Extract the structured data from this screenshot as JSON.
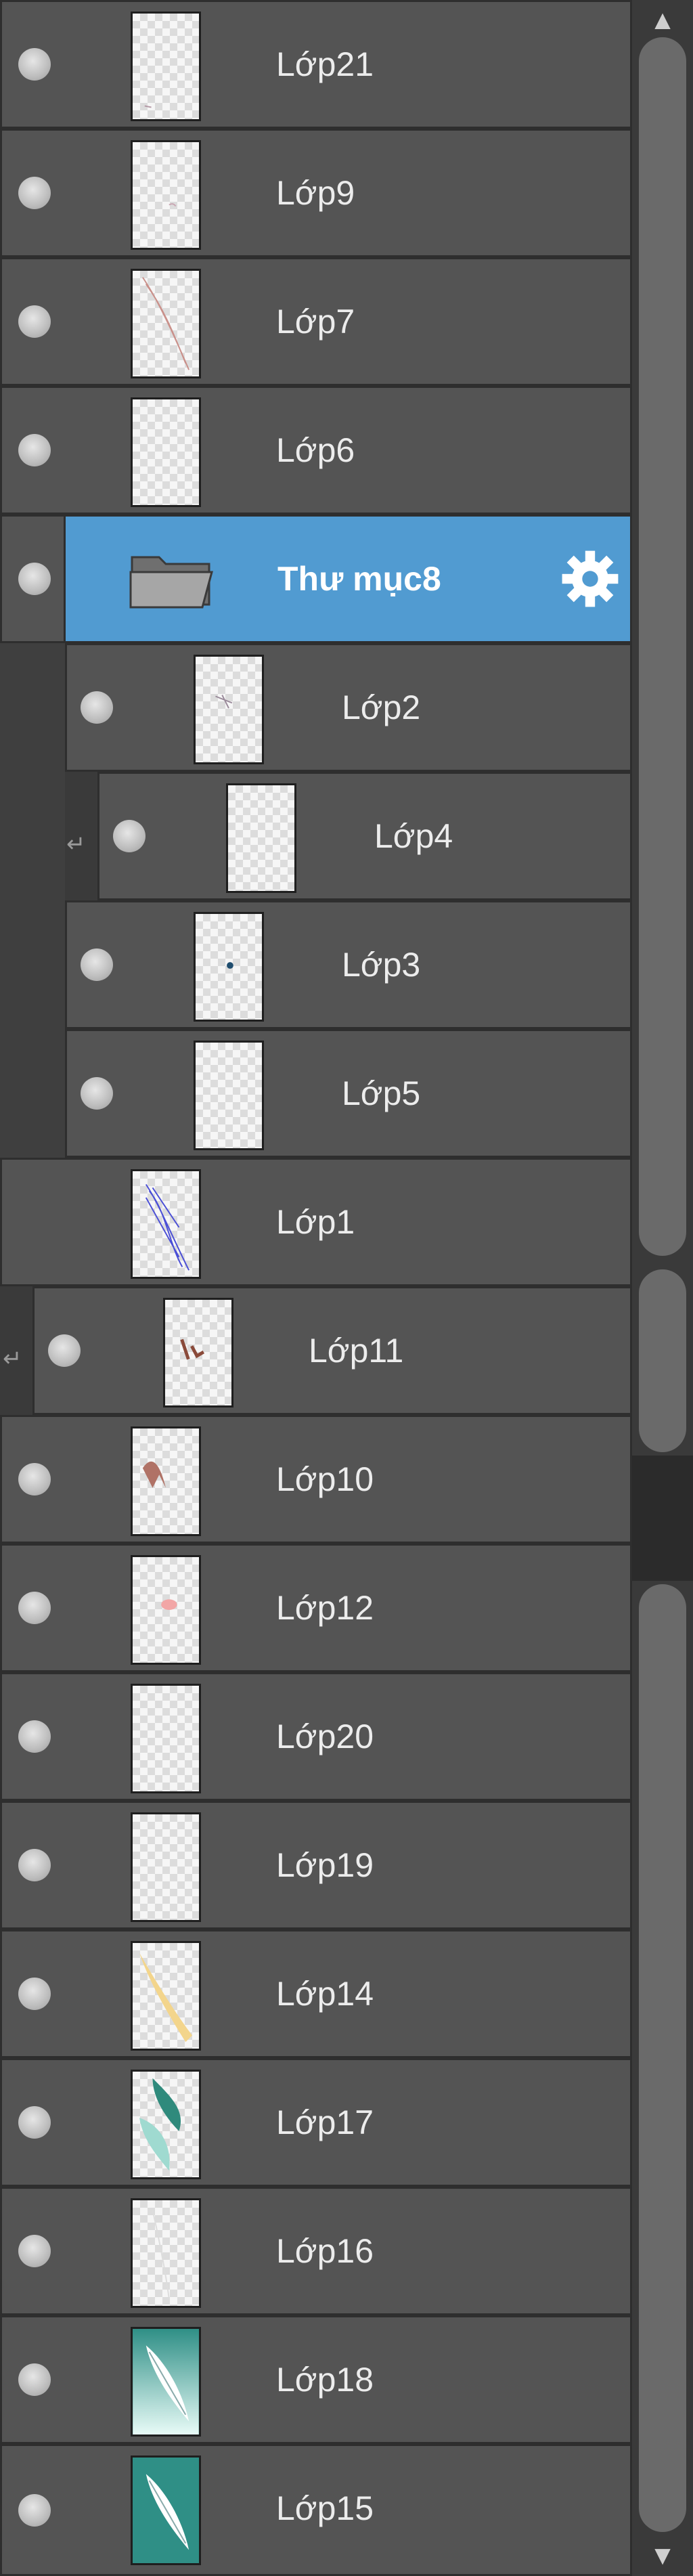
{
  "layers": [
    {
      "name": "Lớp21",
      "visible": true,
      "thumb": "checker"
    },
    {
      "name": "Lớp9",
      "visible": true,
      "thumb": "checker"
    },
    {
      "name": "Lớp7",
      "visible": true,
      "thumb": "checker-sketch"
    },
    {
      "name": "Lớp6",
      "visible": true,
      "thumb": "checker"
    },
    {
      "name": "Thư mục8",
      "visible": true,
      "type": "folder",
      "selected": true,
      "icon": "folder-icon",
      "action_icon": "gear-icon"
    },
    {
      "name": "Lớp2",
      "visible": true,
      "thumb": "checker"
    },
    {
      "name": "Lớp4",
      "visible": true,
      "thumb": "checker",
      "clipping": true
    },
    {
      "name": "Lớp3",
      "visible": true,
      "thumb": "checker-dot"
    },
    {
      "name": "Lớp5",
      "visible": true,
      "thumb": "checker"
    },
    {
      "name": "Lớp1",
      "visible": false,
      "thumb": "checker-blue-sketch"
    },
    {
      "name": "Lớp11",
      "visible": true,
      "thumb": "checker-brown",
      "clipping": true
    },
    {
      "name": "Lớp10",
      "visible": true,
      "thumb": "checker-brown"
    },
    {
      "name": "Lớp12",
      "visible": true,
      "thumb": "checker-pink"
    },
    {
      "name": "Lớp20",
      "visible": true,
      "thumb": "checker"
    },
    {
      "name": "Lớp19",
      "visible": true,
      "thumb": "checker"
    },
    {
      "name": "Lớp14",
      "visible": true,
      "thumb": "checker-yellow"
    },
    {
      "name": "Lớp17",
      "visible": true,
      "thumb": "checker-teal"
    },
    {
      "name": "Lớp16",
      "visible": true,
      "thumb": "checker"
    },
    {
      "name": "Lớp18",
      "visible": true,
      "thumb": "teal-feather"
    },
    {
      "name": "Lớp15",
      "visible": true,
      "thumb": "teal-feather"
    }
  ],
  "colors": {
    "row_bg": "#545454",
    "selected_bg": "#519bd1",
    "panel_bg": "#3a3a3a",
    "scroll_thumb": "#6a6a6a",
    "text": "#ececec"
  },
  "scrollbar": {
    "up_icon": "arrow-up-icon",
    "down_icon": "arrow-down-icon"
  }
}
